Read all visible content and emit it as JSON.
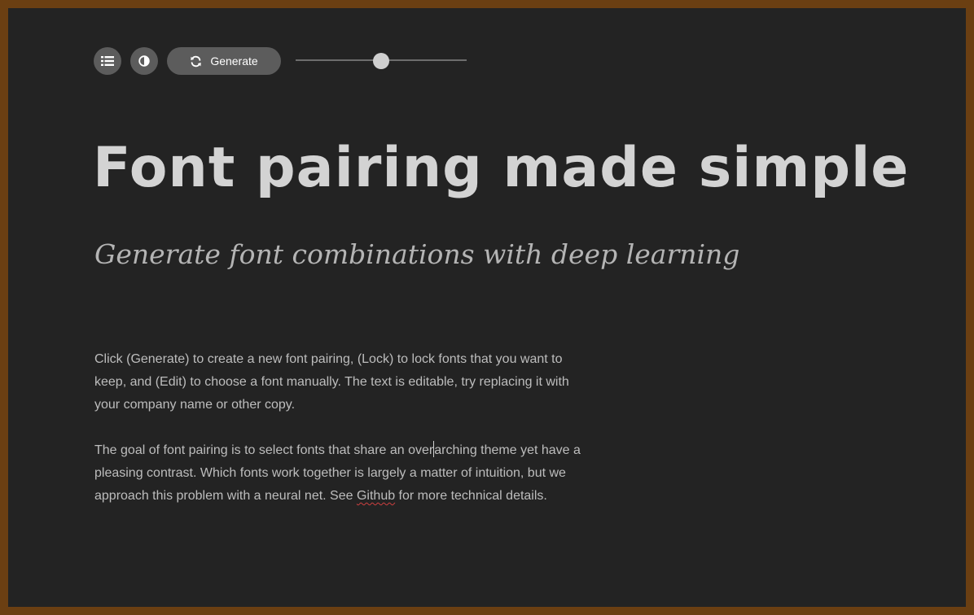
{
  "toolbar": {
    "list_icon": "list-icon",
    "contrast_icon": "contrast-icon",
    "generate_icon": "refresh-icon",
    "generate_label": "Generate",
    "slider_value": 0.5
  },
  "hero": {
    "title": "Font pairing made simple",
    "subtitle": "Generate font combinations with deep learning"
  },
  "body": {
    "paragraph1": "Click (Generate) to create a new font pairing, (Lock) to lock fonts that you want to keep, and (Edit) to choose a font manually. The text is editable, try replacing it with your company name or other copy.",
    "paragraph2_before_caret": "The goal of font pairing is to select fonts that share an over",
    "paragraph2_after_caret": "arching theme yet have a pleasing contrast. Which fonts work together is largely a matter of intuition, but we approach this problem with a neural net. See ",
    "paragraph2_link": "Github",
    "paragraph2_end": " for more technical details."
  },
  "colors": {
    "frame_border": "#6b3f12",
    "background": "#232323",
    "button_bg": "#5c5c5c",
    "title": "#d3d3d3",
    "subtitle": "#b4b4b4",
    "body_text": "#bdbdbd",
    "spellcheck": "#d04040"
  }
}
